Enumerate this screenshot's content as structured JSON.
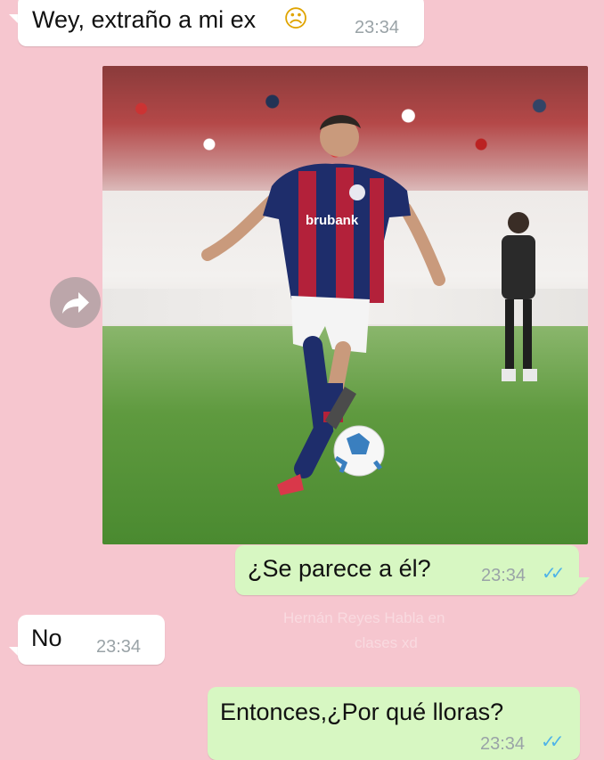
{
  "messages": [
    {
      "side": "in",
      "text": "Wey, extraño a mi ex",
      "emoji": "☹",
      "time": "23:34"
    },
    {
      "side": "out",
      "text": "¿Se parece a él?",
      "time": "23:34",
      "status": "read"
    },
    {
      "side": "in",
      "text": "No",
      "time": "23:34"
    },
    {
      "side": "out",
      "text": "Entonces,¿Por qué lloras?",
      "time": "23:34",
      "status": "read"
    }
  ],
  "photo": {
    "jersey_text": "brubank",
    "subject": "soccer player kicking ball"
  },
  "watermark": {
    "line1": "Hernán Reyes Habla en",
    "line2": "clases xd"
  },
  "icons": {
    "forward": "forward-icon",
    "ticks": "double-check-icon"
  },
  "colors": {
    "background": "#f6c6cf",
    "incoming": "#ffffff",
    "outgoing": "#d7f7c2",
    "read_ticks": "#4fb3e8",
    "timestamp": "#9aa3a7"
  }
}
